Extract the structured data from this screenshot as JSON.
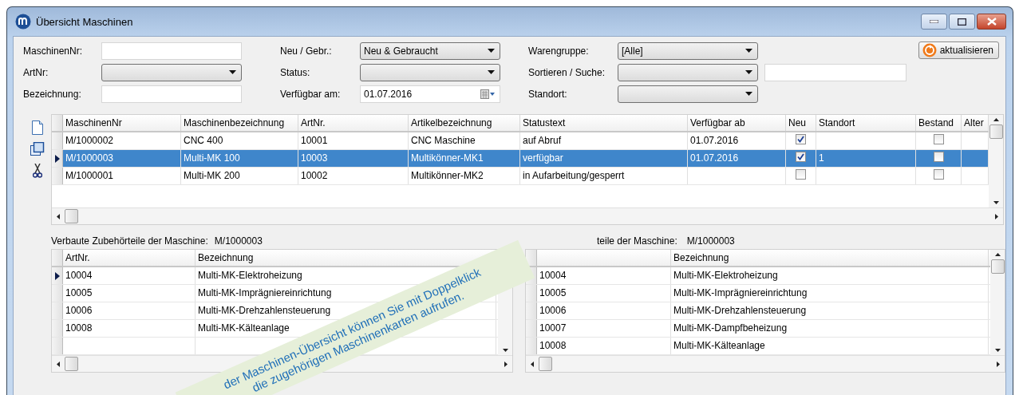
{
  "window": {
    "title": "Übersicht Maschinen"
  },
  "filters": [
    {
      "label": "MaschinenNr:",
      "kind": "text"
    },
    {
      "label": "Neu / Gebr.:",
      "kind": "combo",
      "value": "Neu & Gebraucht"
    },
    {
      "label": "Warengruppe:",
      "kind": "combo",
      "value": "[Alle]"
    },
    {
      "label": "ArtNr:",
      "kind": "combo"
    },
    {
      "label": "Status:",
      "kind": "combo"
    },
    {
      "label": "Sortieren / Suche:",
      "kind": "combo",
      "side_field": true
    },
    {
      "label": "Bezeichnung:",
      "kind": "text"
    },
    {
      "label": "Verfügbar am:",
      "kind": "date",
      "value": "01.07.2016"
    },
    {
      "label": "Standort:",
      "kind": "combo"
    }
  ],
  "refresh_button": {
    "label": "aktualisieren"
  },
  "main_table": {
    "columns": [
      "MaschinenNr",
      "Maschinenbezeichnung",
      "ArtNr.",
      "Artikelbezeichnung",
      "Statustext",
      "Verfügbar ab",
      "Neu",
      "Standort",
      "Bestand",
      "Alter"
    ],
    "rows": [
      {
        "selected": false,
        "maschinen_nr": "M/1000002",
        "bezeichnung": "CNC 400",
        "art_nr": "10001",
        "artikel": "CNC Maschine",
        "status": "auf Abruf",
        "verfuegbar_ab": "01.07.2016",
        "neu": true,
        "bestand": false
      },
      {
        "selected": true,
        "maschinen_nr": "M/1000003",
        "bezeichnung": "Multi-MK 100",
        "art_nr": "10003",
        "artikel": "Multikönner-MK1",
        "status": "verfügbar",
        "verfuegbar_ab": "01.07.2016",
        "neu": true,
        "standort": "1",
        "bestand": false
      },
      {
        "selected": false,
        "maschinen_nr": "M/1000001",
        "bezeichnung": "Multi-MK 200",
        "art_nr": "10002",
        "artikel": "Multikönner-MK2",
        "status": "in Aufarbeitung/gesperrt",
        "neu": false,
        "bestand": false
      }
    ]
  },
  "lower_tables": [
    {
      "label": "Verbaute Zubehörteile der Maschine:",
      "machine": "M/1000003",
      "headers": {
        "art_nr": "ArtNr.",
        "bezeichnung": "Bezeichnung"
      },
      "rows": [
        {
          "current": true,
          "art_nr": "10004",
          "bezeichnung": "Multi-MK-Elektroheizung"
        },
        {
          "current": false,
          "art_nr": "10005",
          "bezeichnung": "Multi-MK-Imprägniereinrichtung"
        },
        {
          "current": false,
          "art_nr": "10006",
          "bezeichnung": "Multi-MK-Drehzahlensteuerung"
        },
        {
          "current": false,
          "art_nr": "10008",
          "bezeichnung": "Multi-MK-Kälteanlage"
        }
      ]
    },
    {
      "label": "teile der Maschine:",
      "machine": "M/1000003",
      "headers": {
        "bezeichnung": "Bezeichnung"
      },
      "rows": [
        {
          "art_nr": "10004",
          "bezeichnung": "Multi-MK-Elektroheizung"
        },
        {
          "art_nr": "10005",
          "bezeichnung": "Multi-MK-Imprägniereinrichtung"
        },
        {
          "art_nr": "10006",
          "bezeichnung": "Multi-MK-Drehzahlensteuerung"
        },
        {
          "art_nr": "10007",
          "bezeichnung": "Multi-MK-Dampfbeheizung"
        },
        {
          "art_nr": "10008",
          "bezeichnung": "Multi-MK-Kälteanlage"
        }
      ]
    }
  ],
  "callout": {
    "text": "der Maschinen-Übersicht können Sie mit Doppelklick die zugehörigen Maschinenkarten aufrufen."
  }
}
